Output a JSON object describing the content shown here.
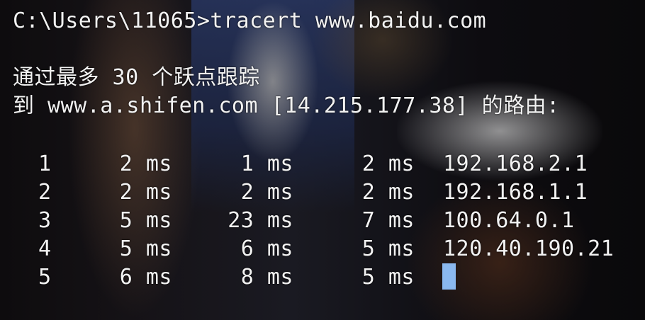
{
  "terminal": {
    "prompt_line": "C:\\Users\\11065>tracert www.baidu.com",
    "header_line1": "通过最多 30 个跃点跟踪",
    "header_line2": "到 www.a.shifen.com [14.215.177.38] 的路由:",
    "hops": [
      {
        "hop": "1",
        "t1": "2 ms",
        "t2": "1 ms",
        "t3": "2 ms",
        "ip": "192.168.2.1"
      },
      {
        "hop": "2",
        "t1": "2 ms",
        "t2": "2 ms",
        "t3": "2 ms",
        "ip": "192.168.1.1"
      },
      {
        "hop": "3",
        "t1": "5 ms",
        "t2": "23 ms",
        "t3": "7 ms",
        "ip": "100.64.0.1"
      },
      {
        "hop": "4",
        "t1": "5 ms",
        "t2": "6 ms",
        "t3": "5 ms",
        "ip": "120.40.190.21"
      },
      {
        "hop": "5",
        "t1": "6 ms",
        "t2": "8 ms",
        "t3": "5 ms",
        "ip": ""
      }
    ],
    "cursor_color": "#8ab8ef",
    "text_color": "#f2f2f2"
  }
}
